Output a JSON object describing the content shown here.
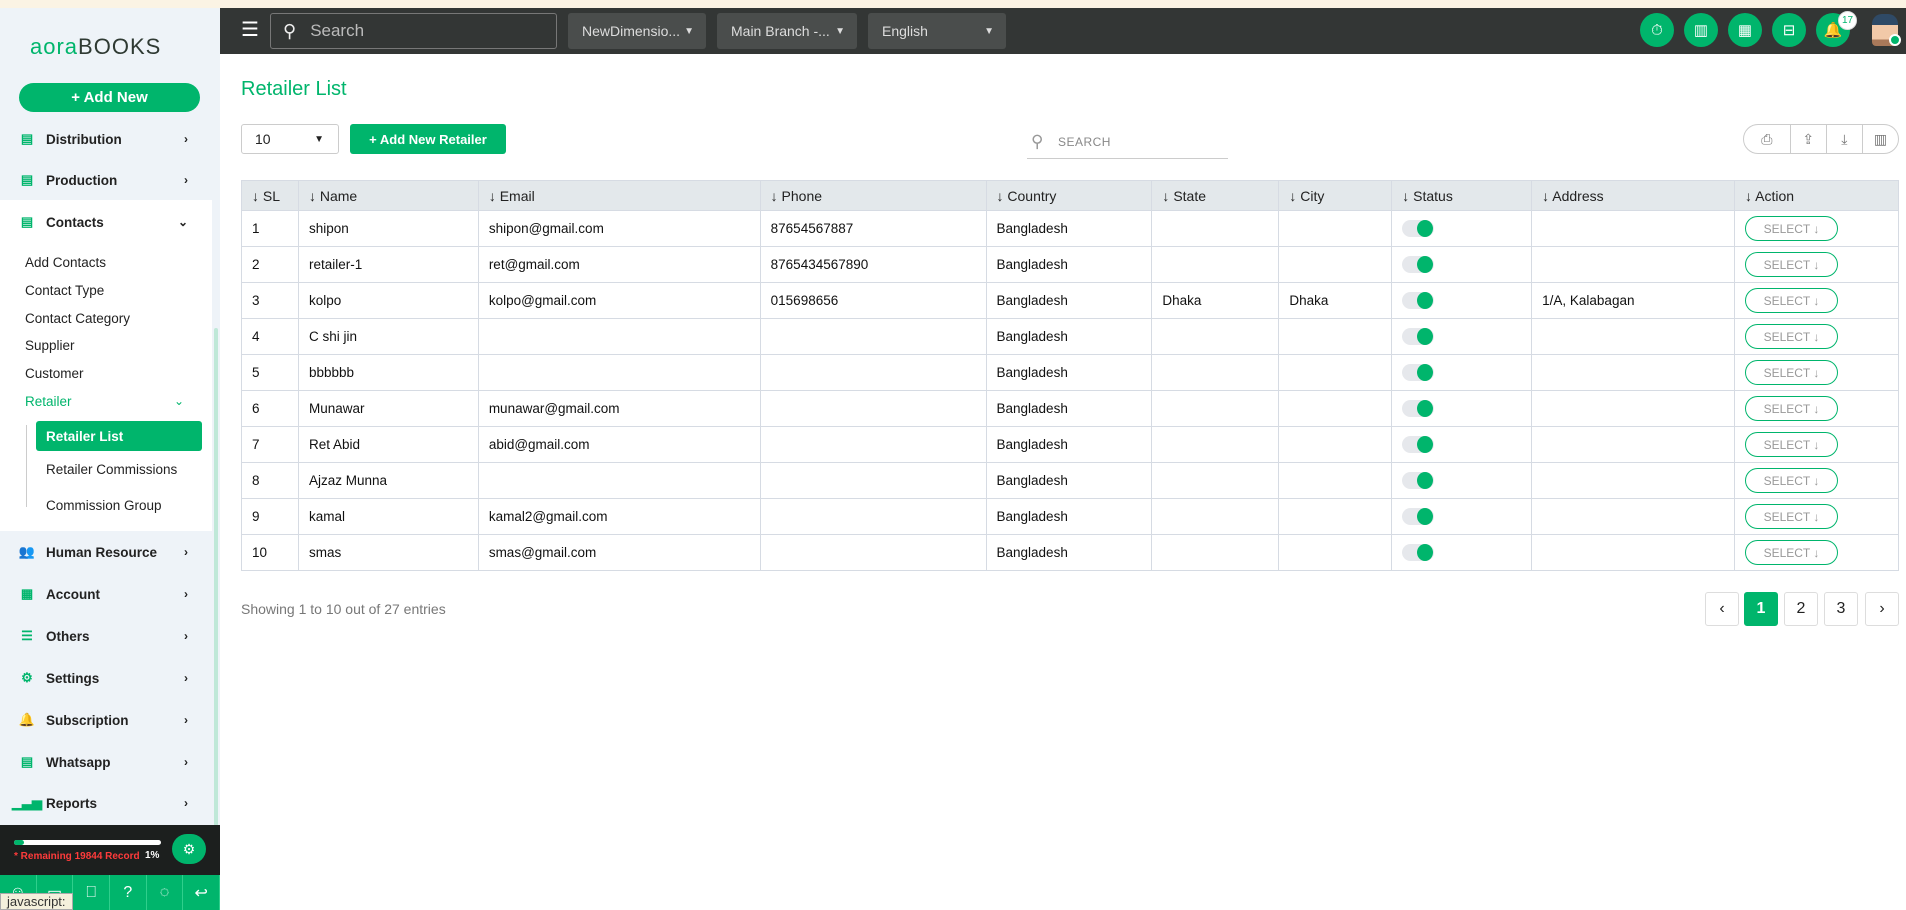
{
  "brand": {
    "logo_left": "aora",
    "logo_right": "BOOKS",
    "accent": "#00b56c"
  },
  "sidebar": {
    "add_new": "+ Add New",
    "items": [
      {
        "label": "Distribution",
        "icon": "document-icon"
      },
      {
        "label": "Production",
        "icon": "document-icon"
      },
      {
        "label": "Contacts",
        "icon": "document-icon"
      },
      {
        "label": "Human Resource",
        "icon": "users-icon"
      },
      {
        "label": "Account",
        "icon": "calculator-icon"
      },
      {
        "label": "Others",
        "icon": "list-icon"
      },
      {
        "label": "Settings",
        "icon": "gear-icon"
      },
      {
        "label": "Subscription",
        "icon": "bell-icon"
      },
      {
        "label": "Whatsapp",
        "icon": "document-icon"
      },
      {
        "label": "Reports",
        "icon": "signal-icon"
      }
    ],
    "contacts_sub": [
      "Add Contacts",
      "Contact Type",
      "Contact Category",
      "Supplier",
      "Customer",
      "Retailer"
    ],
    "retailer_sub": [
      "Retailer List",
      "Retailer Commissions",
      "Commission Group"
    ],
    "remaining": "* Remaining 19844 Record",
    "usage_percent": "1%",
    "tooltip": "javascript:"
  },
  "topbar": {
    "search_placeholder": "Search",
    "company": "NewDimensio...",
    "branch": "Main Branch -...",
    "language": "English",
    "notification_count": "17",
    "icons": [
      "stopwatch-icon",
      "chart-icon",
      "calculator-icon",
      "scan-icon",
      "bell-icon"
    ]
  },
  "main": {
    "title": "Retailer List",
    "page_size": "10",
    "add_button": "+ Add New Retailer",
    "search_placeholder": "SEARCH",
    "columns": [
      "SL",
      "Name",
      "Email",
      "Phone",
      "Country",
      "State",
      "City",
      "Status",
      "Address",
      "Action"
    ],
    "rows": [
      {
        "sl": "1",
        "name": "shipon",
        "email": "shipon@gmail.com",
        "phone": "87654567887",
        "country": "Bangladesh",
        "state": "",
        "city": "",
        "status": true,
        "address": ""
      },
      {
        "sl": "2",
        "name": "retailer-1",
        "email": "ret@gmail.com",
        "phone": "8765434567890",
        "country": "Bangladesh",
        "state": "",
        "city": "",
        "status": true,
        "address": ""
      },
      {
        "sl": "3",
        "name": "kolpo",
        "email": "kolpo@gmail.com",
        "phone": "015698656",
        "country": "Bangladesh",
        "state": "Dhaka",
        "city": "Dhaka",
        "status": true,
        "address": "1/A, Kalabagan"
      },
      {
        "sl": "4",
        "name": "C shi jin",
        "email": "",
        "phone": "",
        "country": "Bangladesh",
        "state": "",
        "city": "",
        "status": true,
        "address": ""
      },
      {
        "sl": "5",
        "name": "bbbbbb",
        "email": "",
        "phone": "",
        "country": "Bangladesh",
        "state": "",
        "city": "",
        "status": true,
        "address": ""
      },
      {
        "sl": "6",
        "name": "Munawar",
        "email": "munawar@gmail.com",
        "phone": "",
        "country": "Bangladesh",
        "state": "",
        "city": "",
        "status": true,
        "address": ""
      },
      {
        "sl": "7",
        "name": "Ret Abid",
        "email": "abid@gmail.com",
        "phone": "",
        "country": "Bangladesh",
        "state": "",
        "city": "",
        "status": true,
        "address": ""
      },
      {
        "sl": "8",
        "name": "Ajzaz Munna",
        "email": "",
        "phone": "",
        "country": "Bangladesh",
        "state": "",
        "city": "",
        "status": true,
        "address": ""
      },
      {
        "sl": "9",
        "name": "kamal",
        "email": "kamal2@gmail.com",
        "phone": "",
        "country": "Bangladesh",
        "state": "",
        "city": "",
        "status": true,
        "address": ""
      },
      {
        "sl": "10",
        "name": "smas",
        "email": "smas@gmail.com",
        "phone": "",
        "country": "Bangladesh",
        "state": "",
        "city": "",
        "status": true,
        "address": ""
      }
    ],
    "action_label": "SELECT ↓",
    "showing": "Showing 1 to 10 out of 27 entries",
    "pages": [
      "1",
      "2",
      "3"
    ],
    "current_page": "1"
  }
}
